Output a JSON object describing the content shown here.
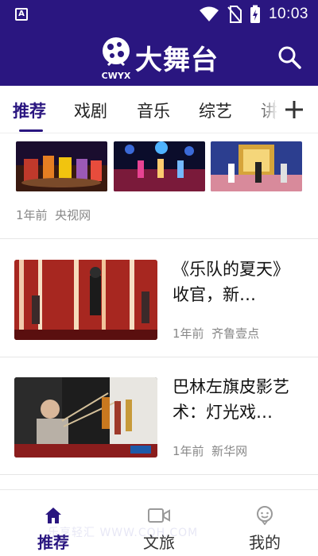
{
  "status_bar": {
    "time": "10:03",
    "accessibility_badge": "A"
  },
  "header": {
    "brand_name": "大舞台",
    "logo_text": "CWYX",
    "search_icon": "search-icon"
  },
  "tabs": [
    {
      "label": "推荐",
      "active": true
    },
    {
      "label": "戏剧",
      "active": false
    },
    {
      "label": "音乐",
      "active": false
    },
    {
      "label": "综艺",
      "active": false
    },
    {
      "label": "讲",
      "active": false
    }
  ],
  "add_tab_icon": "plus-icon",
  "feed": {
    "items": [
      {
        "layout": "three-image",
        "time": "1年前",
        "source": "央视网"
      },
      {
        "layout": "single-image",
        "title": "《乐队的夏天》收官，新…",
        "time": "1年前",
        "source": "齐鲁壹点"
      },
      {
        "layout": "single-image",
        "title": "巴林左旗皮影艺术：灯光戏…",
        "time": "1年前",
        "source": "新华网"
      }
    ]
  },
  "bottom_nav": [
    {
      "label": "推荐",
      "icon": "home-icon",
      "active": true
    },
    {
      "label": "文旅",
      "icon": "video-camera-icon",
      "active": false
    },
    {
      "label": "我的",
      "icon": "user-face-icon",
      "active": false
    }
  ],
  "watermark": "乐享轻汇 WWW.CQH.COM",
  "colors": {
    "brand": "#2a1680",
    "meta": "#888888",
    "divider": "#e6e6e6"
  }
}
